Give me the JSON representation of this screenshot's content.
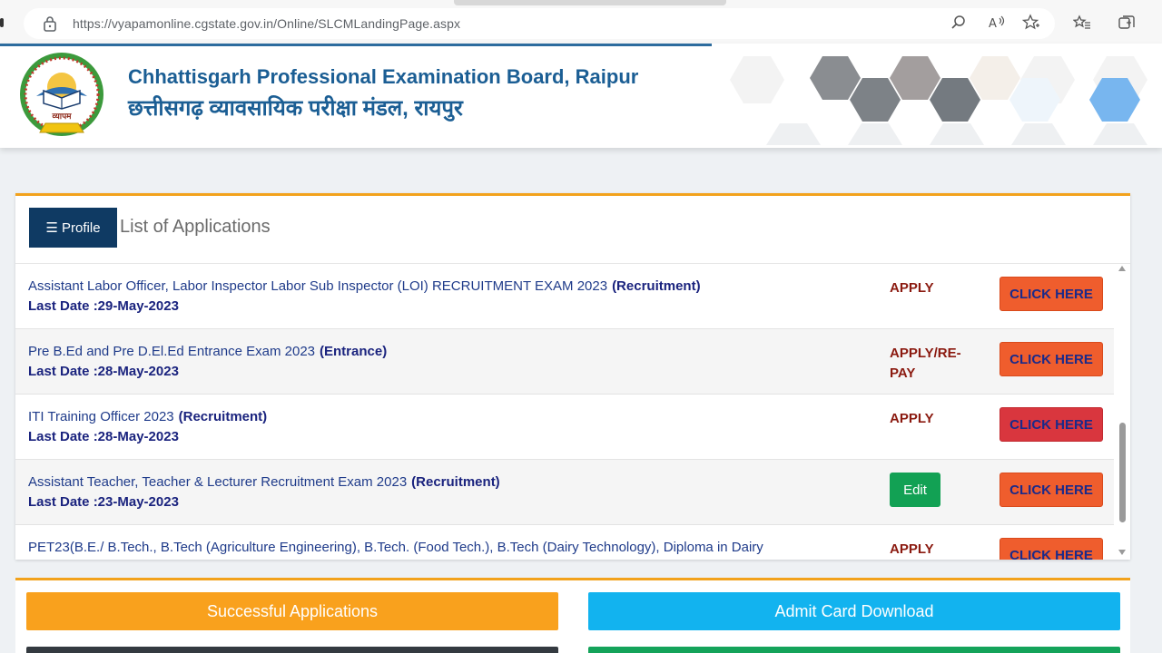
{
  "browser": {
    "url": "https://vyapamonline.cgstate.gov.in/Online/SLCMLandingPage.aspx",
    "icons": [
      "lock-icon",
      "search-icon",
      "read-aloud-icon",
      "favorite-add-icon",
      "favorites-icon",
      "collections-icon"
    ]
  },
  "header": {
    "title_en": "Chhattisgarh Professional Examination Board, Raipur",
    "title_hi": "छत्तीसगढ़ व्यावसायिक परीक्षा मंडल, रायपुर",
    "logo_text": "व्यापम"
  },
  "panel": {
    "profile_label": "☰ Profile",
    "title": "List of Applications"
  },
  "applications": [
    {
      "name": "Assistant Labor Officer, Labor Inspector Labor Sub Inspector (LOI) RECRUITMENT EXAM 2023",
      "type": "(Recruitment)",
      "last_date": "Last Date :29-May-2023",
      "action": "APPLY",
      "button": "CLICK HERE"
    },
    {
      "name": "Pre B.Ed and Pre D.El.Ed Entrance Exam 2023",
      "type": "(Entrance)",
      "last_date": "Last Date :28-May-2023",
      "action": "APPLY/RE-PAY",
      "button": "CLICK HERE"
    },
    {
      "name": "ITI Training Officer 2023",
      "type": "(Recruitment)",
      "last_date": "Last Date :28-May-2023",
      "action": "APPLY",
      "button": "CLICK HERE"
    },
    {
      "name": "Assistant Teacher, Teacher & Lecturer Recruitment Exam 2023",
      "type": "(Recruitment)",
      "last_date": "Last Date :23-May-2023",
      "action": "Edit",
      "button": "CLICK HERE"
    },
    {
      "name": "PET23(B.E./ B.Tech., B.Tech (Agriculture Engineering), B.Tech. (Food Tech.), B.Tech (Dairy Technology), Diploma in Dairy",
      "type": "",
      "last_date": "",
      "action": "APPLY",
      "button": "CLICK HERE"
    }
  ],
  "bottom": {
    "successful_label": "Successful Applications",
    "admit_label": "Admit Card Download"
  },
  "colors": {
    "brand_blue": "#1b5e94",
    "navy": "#0f3a63",
    "accent_orange": "#f2a21c",
    "click_button": "#ef5d2d",
    "edit_button": "#12a154",
    "admit_button": "#12b3ef"
  }
}
